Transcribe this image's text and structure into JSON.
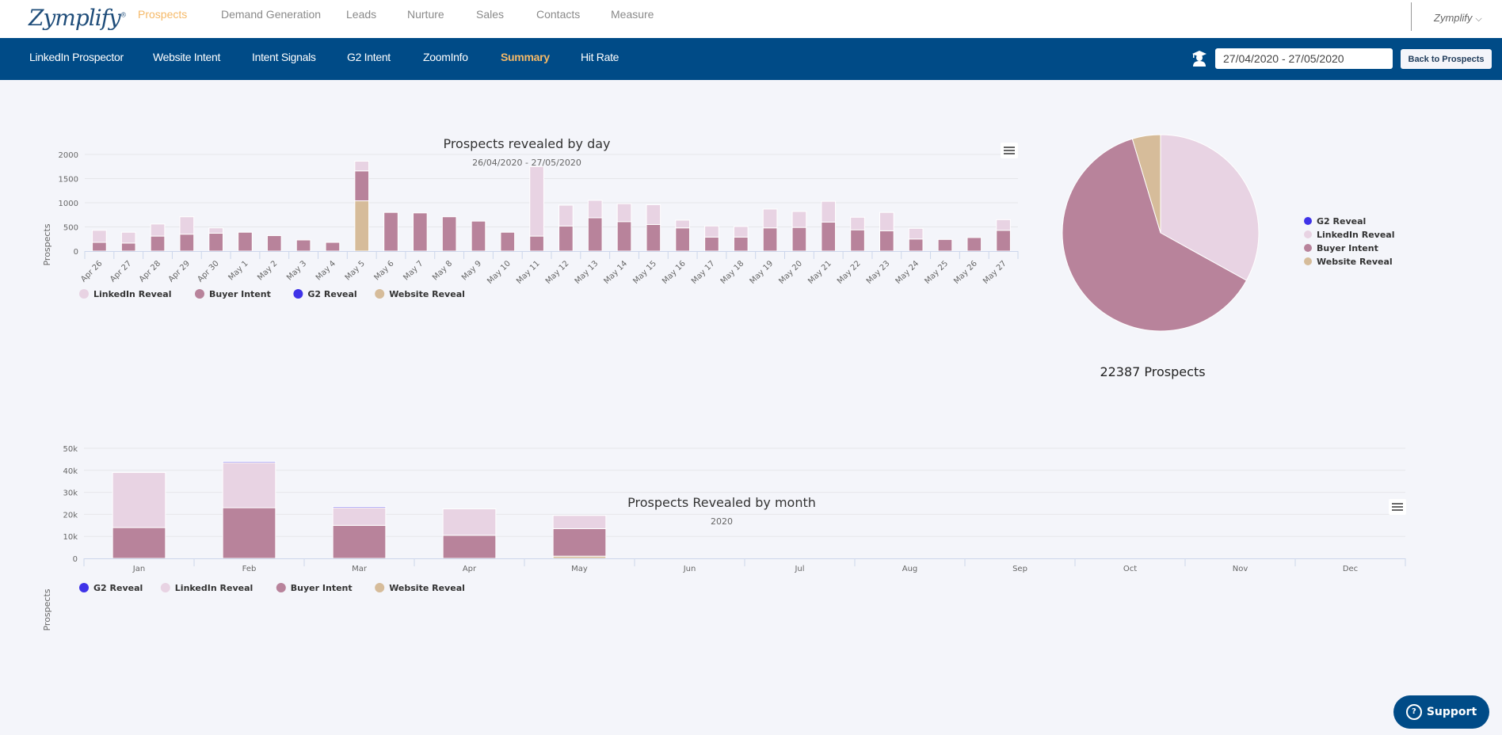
{
  "topnav": {
    "logo": "Zymplify",
    "items": [
      {
        "label": "Prospects",
        "active": true
      },
      {
        "label": "Demand Generation",
        "active": false
      },
      {
        "label": "Leads",
        "active": false
      },
      {
        "label": "Nurture",
        "active": false
      },
      {
        "label": "Sales",
        "active": false
      },
      {
        "label": "Contacts",
        "active": false
      },
      {
        "label": "Measure",
        "active": false
      }
    ],
    "account": "Zymplify",
    "account_icon": "chevron-down-icon"
  },
  "subnav": {
    "items": [
      {
        "label": "LinkedIn Prospector",
        "active": false
      },
      {
        "label": "Website Intent",
        "active": false
      },
      {
        "label": "Intent Signals",
        "active": false
      },
      {
        "label": "G2 Intent",
        "active": false
      },
      {
        "label": "ZoomInfo",
        "active": false
      },
      {
        "label": "Summary",
        "active": true
      },
      {
        "label": "Hit Rate",
        "active": false
      }
    ],
    "tutorial_icon": "graduation-cap-user-icon",
    "date_range": "27/04/2020 - 27/05/2020",
    "back_button": "Back to Prospects"
  },
  "colors": {
    "linkedin": "#e8d3e3",
    "buyer": "#b8839b",
    "g2": "#3f33e8",
    "website": "#d6bc9a",
    "brand": "#004b87",
    "accent": "#f5b968"
  },
  "support_button": "Support",
  "chart_data": [
    {
      "id": "daily",
      "type": "bar",
      "stacked": true,
      "title": "Prospects revealed by day",
      "subtitle": "26/04/2020 - 27/05/2020",
      "xlabel": "",
      "ylabel": "Prospects",
      "ylim": [
        0,
        2000
      ],
      "yticks": [
        0,
        500,
        1000,
        1500,
        2000
      ],
      "grid": true,
      "legend_position": "bottom-left",
      "categories": [
        "Apr 26",
        "Apr 27",
        "Apr 28",
        "Apr 29",
        "Apr 30",
        "May 1",
        "May 2",
        "May 3",
        "May 4",
        "May 5",
        "May 6",
        "May 7",
        "May 8",
        "May 9",
        "May 10",
        "May 11",
        "May 12",
        "May 13",
        "May 14",
        "May 15",
        "May 16",
        "May 17",
        "May 18",
        "May 19",
        "May 20",
        "May 21",
        "May 22",
        "May 23",
        "May 24",
        "May 25",
        "May 26",
        "May 27"
      ],
      "series": [
        {
          "name": "Website Reveal",
          "color_key": "website",
          "values": [
            0,
            0,
            0,
            0,
            0,
            0,
            0,
            0,
            0,
            1040,
            0,
            0,
            0,
            0,
            0,
            0,
            0,
            0,
            0,
            0,
            0,
            0,
            0,
            0,
            0,
            0,
            0,
            0,
            0,
            0,
            0,
            0
          ]
        },
        {
          "name": "Buyer Intent",
          "color_key": "buyer",
          "values": [
            180,
            165,
            310,
            350,
            370,
            390,
            320,
            230,
            180,
            620,
            800,
            790,
            710,
            620,
            390,
            310,
            520,
            690,
            610,
            550,
            480,
            290,
            290,
            480,
            490,
            600,
            440,
            420,
            250,
            240,
            280,
            430
          ]
        },
        {
          "name": "G2 Reveal",
          "color_key": "g2",
          "values": [
            0,
            0,
            0,
            0,
            0,
            0,
            0,
            0,
            0,
            0,
            0,
            0,
            0,
            0,
            0,
            0,
            0,
            0,
            0,
            0,
            0,
            0,
            0,
            0,
            0,
            0,
            0,
            0,
            0,
            0,
            0,
            0
          ]
        },
        {
          "name": "LinkedIn Reveal",
          "color_key": "linkedin",
          "values": [
            250,
            225,
            250,
            360,
            110,
            0,
            0,
            0,
            0,
            200,
            0,
            0,
            0,
            0,
            0,
            1440,
            430,
            360,
            370,
            410,
            160,
            230,
            220,
            390,
            330,
            430,
            260,
            380,
            220,
            0,
            0,
            220
          ]
        }
      ],
      "legend": [
        {
          "name": "LinkedIn Reveal",
          "color_key": "linkedin"
        },
        {
          "name": "Buyer Intent",
          "color_key": "buyer"
        },
        {
          "name": "G2 Reveal",
          "color_key": "g2"
        },
        {
          "name": "Website Reveal",
          "color_key": "website"
        }
      ]
    },
    {
      "id": "pie",
      "type": "pie",
      "title": "",
      "total_label": "22387 Prospects",
      "legend_position": "right",
      "slices": [
        {
          "name": "G2 Reveal",
          "color_key": "g2",
          "value": 0
        },
        {
          "name": "LinkedIn Reveal",
          "color_key": "linkedin",
          "value": 7400
        },
        {
          "name": "Buyer Intent",
          "color_key": "buyer",
          "value": 13947
        },
        {
          "name": "Website Reveal",
          "color_key": "website",
          "value": 1040
        }
      ]
    },
    {
      "id": "monthly",
      "type": "bar",
      "stacked": true,
      "title": "Prospects Revealed by month",
      "subtitle": "2020",
      "xlabel": "",
      "ylabel": "Prospects",
      "ylim": [
        0,
        50000
      ],
      "yticks": [
        0,
        10000,
        20000,
        30000,
        40000,
        50000
      ],
      "ytick_labels": [
        "0",
        "10k",
        "20k",
        "30k",
        "40k",
        "50k"
      ],
      "grid": true,
      "legend_position": "bottom-left",
      "categories": [
        "Jan",
        "Feb",
        "Mar",
        "Apr",
        "May",
        "Jun",
        "Jul",
        "Aug",
        "Sep",
        "Oct",
        "Nov",
        "Dec"
      ],
      "series": [
        {
          "name": "Website Reveal",
          "color_key": "website",
          "values": [
            0,
            0,
            0,
            0,
            1000,
            0,
            0,
            0,
            0,
            0,
            0,
            0
          ]
        },
        {
          "name": "Buyer Intent",
          "color_key": "buyer",
          "values": [
            14000,
            23000,
            15000,
            10500,
            12500,
            0,
            0,
            0,
            0,
            0,
            0,
            0
          ]
        },
        {
          "name": "LinkedIn Reveal",
          "color_key": "linkedin",
          "values": [
            25000,
            20500,
            8000,
            12000,
            6000,
            0,
            0,
            0,
            0,
            0,
            0,
            0
          ]
        },
        {
          "name": "G2 Reveal",
          "color_key": "g2",
          "values": [
            0,
            500,
            500,
            0,
            0,
            0,
            0,
            0,
            0,
            0,
            0,
            0
          ]
        }
      ],
      "legend": [
        {
          "name": "G2 Reveal",
          "color_key": "g2"
        },
        {
          "name": "LinkedIn Reveal",
          "color_key": "linkedin"
        },
        {
          "name": "Buyer Intent",
          "color_key": "buyer"
        },
        {
          "name": "Website Reveal",
          "color_key": "website"
        }
      ]
    }
  ]
}
